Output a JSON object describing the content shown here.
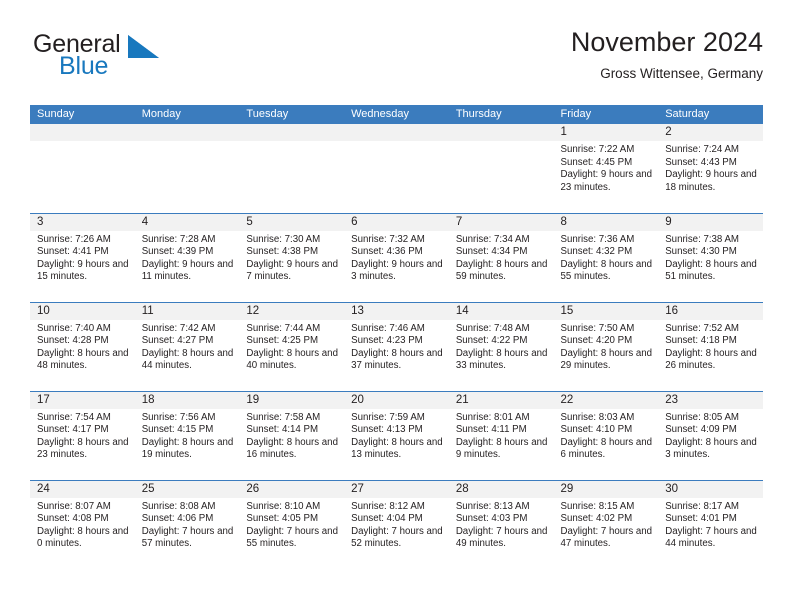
{
  "brand": {
    "name_part1": "General",
    "name_part2": "Blue",
    "mark_icon": "triangle-flag-icon",
    "accent_color": "#1878be"
  },
  "header": {
    "title": "November 2024",
    "location": "Gross Wittensee, Germany"
  },
  "theme": {
    "header_row_color": "#3b7cbe",
    "daynum_band_color": "#f2f2f2",
    "text_color": "#231f20"
  },
  "calendar": {
    "weekday_headers": [
      "Sunday",
      "Monday",
      "Tuesday",
      "Wednesday",
      "Thursday",
      "Friday",
      "Saturday"
    ],
    "weeks": [
      [
        {
          "empty": true
        },
        {
          "empty": true
        },
        {
          "empty": true
        },
        {
          "empty": true
        },
        {
          "empty": true
        },
        {
          "day": "1",
          "sunrise": "Sunrise: 7:22 AM",
          "sunset": "Sunset: 4:45 PM",
          "daylight": "Daylight: 9 hours and 23 minutes."
        },
        {
          "day": "2",
          "sunrise": "Sunrise: 7:24 AM",
          "sunset": "Sunset: 4:43 PM",
          "daylight": "Daylight: 9 hours and 18 minutes."
        }
      ],
      [
        {
          "day": "3",
          "sunrise": "Sunrise: 7:26 AM",
          "sunset": "Sunset: 4:41 PM",
          "daylight": "Daylight: 9 hours and 15 minutes."
        },
        {
          "day": "4",
          "sunrise": "Sunrise: 7:28 AM",
          "sunset": "Sunset: 4:39 PM",
          "daylight": "Daylight: 9 hours and 11 minutes."
        },
        {
          "day": "5",
          "sunrise": "Sunrise: 7:30 AM",
          "sunset": "Sunset: 4:38 PM",
          "daylight": "Daylight: 9 hours and 7 minutes."
        },
        {
          "day": "6",
          "sunrise": "Sunrise: 7:32 AM",
          "sunset": "Sunset: 4:36 PM",
          "daylight": "Daylight: 9 hours and 3 minutes."
        },
        {
          "day": "7",
          "sunrise": "Sunrise: 7:34 AM",
          "sunset": "Sunset: 4:34 PM",
          "daylight": "Daylight: 8 hours and 59 minutes."
        },
        {
          "day": "8",
          "sunrise": "Sunrise: 7:36 AM",
          "sunset": "Sunset: 4:32 PM",
          "daylight": "Daylight: 8 hours and 55 minutes."
        },
        {
          "day": "9",
          "sunrise": "Sunrise: 7:38 AM",
          "sunset": "Sunset: 4:30 PM",
          "daylight": "Daylight: 8 hours and 51 minutes."
        }
      ],
      [
        {
          "day": "10",
          "sunrise": "Sunrise: 7:40 AM",
          "sunset": "Sunset: 4:28 PM",
          "daylight": "Daylight: 8 hours and 48 minutes."
        },
        {
          "day": "11",
          "sunrise": "Sunrise: 7:42 AM",
          "sunset": "Sunset: 4:27 PM",
          "daylight": "Daylight: 8 hours and 44 minutes."
        },
        {
          "day": "12",
          "sunrise": "Sunrise: 7:44 AM",
          "sunset": "Sunset: 4:25 PM",
          "daylight": "Daylight: 8 hours and 40 minutes."
        },
        {
          "day": "13",
          "sunrise": "Sunrise: 7:46 AM",
          "sunset": "Sunset: 4:23 PM",
          "daylight": "Daylight: 8 hours and 37 minutes."
        },
        {
          "day": "14",
          "sunrise": "Sunrise: 7:48 AM",
          "sunset": "Sunset: 4:22 PM",
          "daylight": "Daylight: 8 hours and 33 minutes."
        },
        {
          "day": "15",
          "sunrise": "Sunrise: 7:50 AM",
          "sunset": "Sunset: 4:20 PM",
          "daylight": "Daylight: 8 hours and 29 minutes."
        },
        {
          "day": "16",
          "sunrise": "Sunrise: 7:52 AM",
          "sunset": "Sunset: 4:18 PM",
          "daylight": "Daylight: 8 hours and 26 minutes."
        }
      ],
      [
        {
          "day": "17",
          "sunrise": "Sunrise: 7:54 AM",
          "sunset": "Sunset: 4:17 PM",
          "daylight": "Daylight: 8 hours and 23 minutes."
        },
        {
          "day": "18",
          "sunrise": "Sunrise: 7:56 AM",
          "sunset": "Sunset: 4:15 PM",
          "daylight": "Daylight: 8 hours and 19 minutes."
        },
        {
          "day": "19",
          "sunrise": "Sunrise: 7:58 AM",
          "sunset": "Sunset: 4:14 PM",
          "daylight": "Daylight: 8 hours and 16 minutes."
        },
        {
          "day": "20",
          "sunrise": "Sunrise: 7:59 AM",
          "sunset": "Sunset: 4:13 PM",
          "daylight": "Daylight: 8 hours and 13 minutes."
        },
        {
          "day": "21",
          "sunrise": "Sunrise: 8:01 AM",
          "sunset": "Sunset: 4:11 PM",
          "daylight": "Daylight: 8 hours and 9 minutes."
        },
        {
          "day": "22",
          "sunrise": "Sunrise: 8:03 AM",
          "sunset": "Sunset: 4:10 PM",
          "daylight": "Daylight: 8 hours and 6 minutes."
        },
        {
          "day": "23",
          "sunrise": "Sunrise: 8:05 AM",
          "sunset": "Sunset: 4:09 PM",
          "daylight": "Daylight: 8 hours and 3 minutes."
        }
      ],
      [
        {
          "day": "24",
          "sunrise": "Sunrise: 8:07 AM",
          "sunset": "Sunset: 4:08 PM",
          "daylight": "Daylight: 8 hours and 0 minutes."
        },
        {
          "day": "25",
          "sunrise": "Sunrise: 8:08 AM",
          "sunset": "Sunset: 4:06 PM",
          "daylight": "Daylight: 7 hours and 57 minutes."
        },
        {
          "day": "26",
          "sunrise": "Sunrise: 8:10 AM",
          "sunset": "Sunset: 4:05 PM",
          "daylight": "Daylight: 7 hours and 55 minutes."
        },
        {
          "day": "27",
          "sunrise": "Sunrise: 8:12 AM",
          "sunset": "Sunset: 4:04 PM",
          "daylight": "Daylight: 7 hours and 52 minutes."
        },
        {
          "day": "28",
          "sunrise": "Sunrise: 8:13 AM",
          "sunset": "Sunset: 4:03 PM",
          "daylight": "Daylight: 7 hours and 49 minutes."
        },
        {
          "day": "29",
          "sunrise": "Sunrise: 8:15 AM",
          "sunset": "Sunset: 4:02 PM",
          "daylight": "Daylight: 7 hours and 47 minutes."
        },
        {
          "day": "30",
          "sunrise": "Sunrise: 8:17 AM",
          "sunset": "Sunset: 4:01 PM",
          "daylight": "Daylight: 7 hours and 44 minutes."
        }
      ]
    ]
  }
}
